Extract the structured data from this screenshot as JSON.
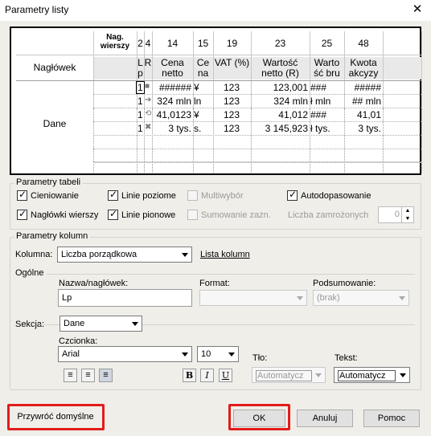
{
  "window": {
    "title": "Parametry listy",
    "close_glyph": "✕"
  },
  "preview": {
    "header_col": "Nag. wierszy",
    "col_numbers": [
      "2",
      "4",
      "14",
      "15",
      "19",
      "23",
      "25",
      "48"
    ],
    "col_names": [
      "L p",
      "R",
      "Cena netto",
      "Ce na",
      "VAT (%)",
      "Wartość netto (R)",
      "Warto ść bru",
      "Kwota akcyzy"
    ],
    "row_labels": {
      "header": "Nagłówek",
      "data": "Dane"
    },
    "rows": [
      [
        "1",
        "",
        "######",
        "¥",
        "123",
        "123,001",
        "###",
        "#####"
      ],
      [
        "1",
        "",
        "324 mln",
        "ln",
        "123",
        "324 mln",
        "ł mln",
        "## mln"
      ],
      [
        "1",
        "",
        "41,0123",
        "¥",
        "123",
        "41,012",
        "###",
        "41,01"
      ],
      [
        "1",
        "",
        "3 tys.",
        "s.",
        "123",
        "3 145,923",
        "ł tys.",
        "3 tys."
      ]
    ]
  },
  "table_params": {
    "title": "Parametry tabeli",
    "shading": "Cieniowanie",
    "horizontal_lines": "Linie poziome",
    "multiselect": "Multiwybór",
    "autofit": "Autodopasowanie",
    "row_headers": "Nagłówki wierszy",
    "vertical_lines": "Linie pionowe",
    "summing": "Sumowanie zazn.",
    "frozen_label": "Liczba zamrożonych",
    "frozen_value": "0"
  },
  "column_params": {
    "title": "Parametry kolumn",
    "column_label": "Kolumna:",
    "column_value": "Liczba porządkowa",
    "column_list_link": "Lista kolumn",
    "general": "Ogólne",
    "name_label": "Nazwa/nagłówek:",
    "name_value": "Lp",
    "format_label": "Format:",
    "format_value": "",
    "summary_label": "Podsumowanie:",
    "summary_value": "(brak)",
    "section_label": "Sekcja:",
    "section_value": "Dane",
    "font_label": "Czcionka:",
    "font_value": "Arial",
    "size_value": "10",
    "bg_label": "Tło:",
    "bg_value": "Automatycz",
    "text_label": "Tekst:",
    "text_value": "Automatycz",
    "bold": "B",
    "italic": "I",
    "underline": "U"
  },
  "buttons": {
    "restore": "Przywróć domyślne",
    "ok": "OK",
    "cancel": "Anuluj",
    "help": "Pomoc"
  },
  "colors": {
    "highlight": "#e21c1c",
    "panel": "#f0eee9"
  }
}
